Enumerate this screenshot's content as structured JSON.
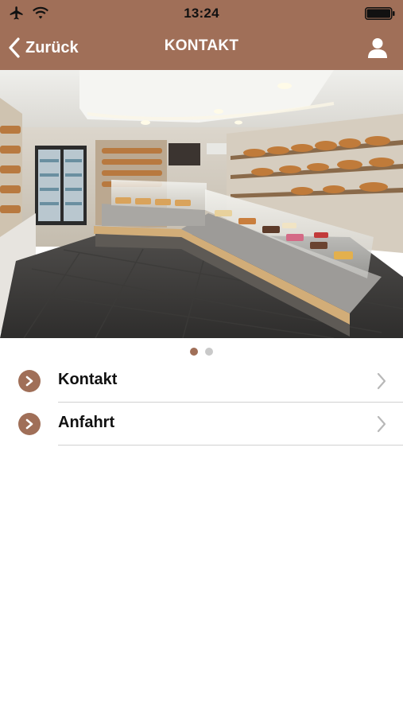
{
  "status_bar": {
    "time": "13:24",
    "icons": [
      "airplane-icon",
      "wifi-icon",
      "battery-icon"
    ]
  },
  "nav_bar": {
    "back_label": "Zurück",
    "title": "KONTAKT",
    "right_icon": "user-icon"
  },
  "hero": {
    "pages": 2,
    "active_page": 1
  },
  "menu": {
    "items": [
      {
        "label": "Kontakt",
        "icon": "chevron-right-circle-icon"
      },
      {
        "label": "Anfahrt",
        "icon": "chevron-right-circle-icon"
      }
    ]
  },
  "colors": {
    "accent": "#a06f58",
    "text": "#111111",
    "divider": "#d0d0d0",
    "inactive_dot": "#c9c9c9"
  }
}
